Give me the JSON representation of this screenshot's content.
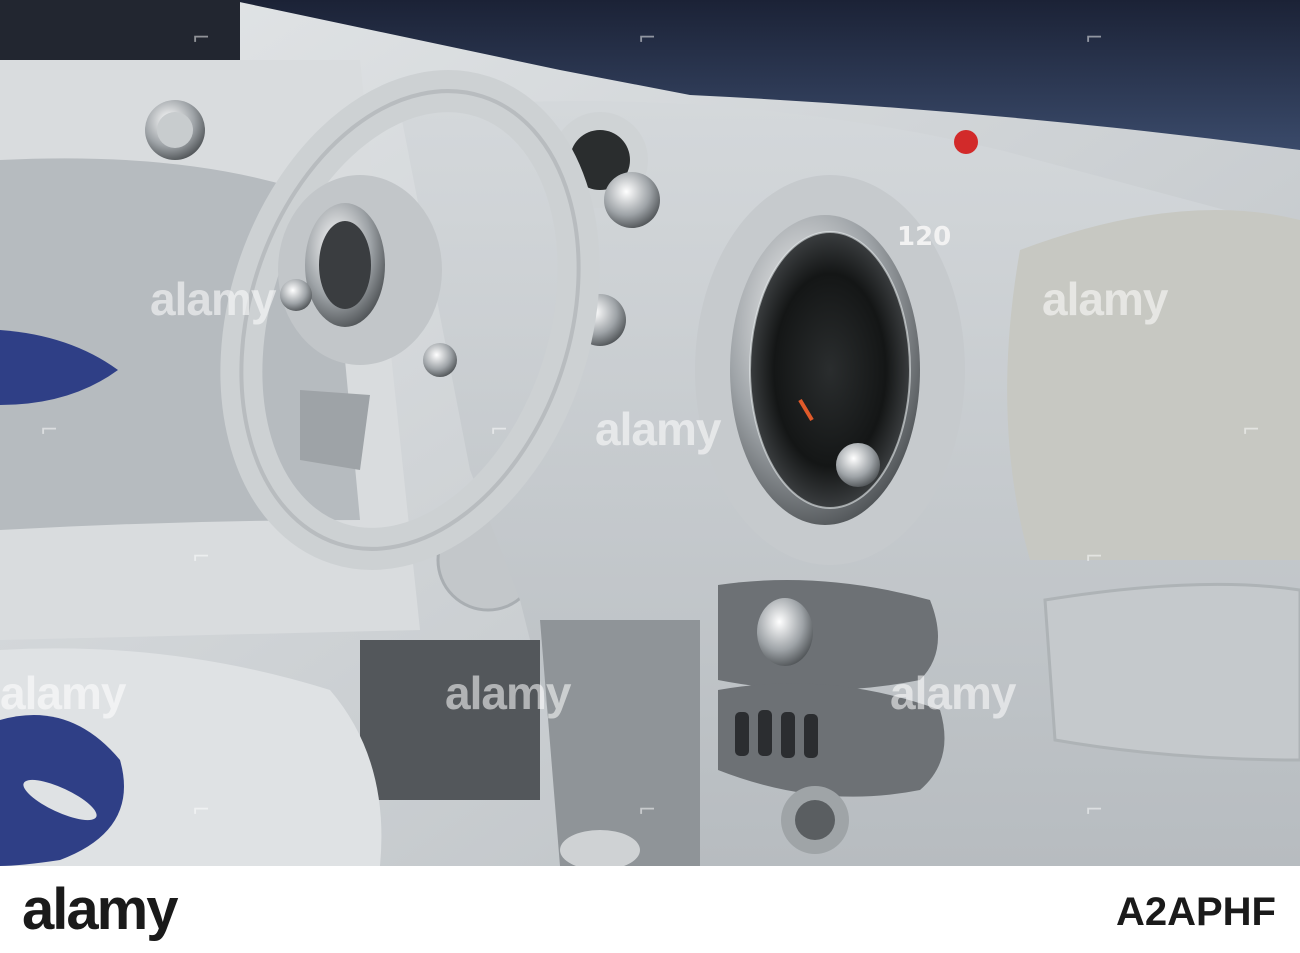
{
  "photo": {
    "watermark_text": "alamy",
    "speedometer_reading": "120"
  },
  "footer": {
    "brand": "alamy",
    "image_id": "A2APHF"
  },
  "colors": {
    "interior": "#c9cdd0",
    "accent_blue": "#2f3f86",
    "footer_bg": "#ffffff",
    "footer_text": "#1a1a1a"
  }
}
